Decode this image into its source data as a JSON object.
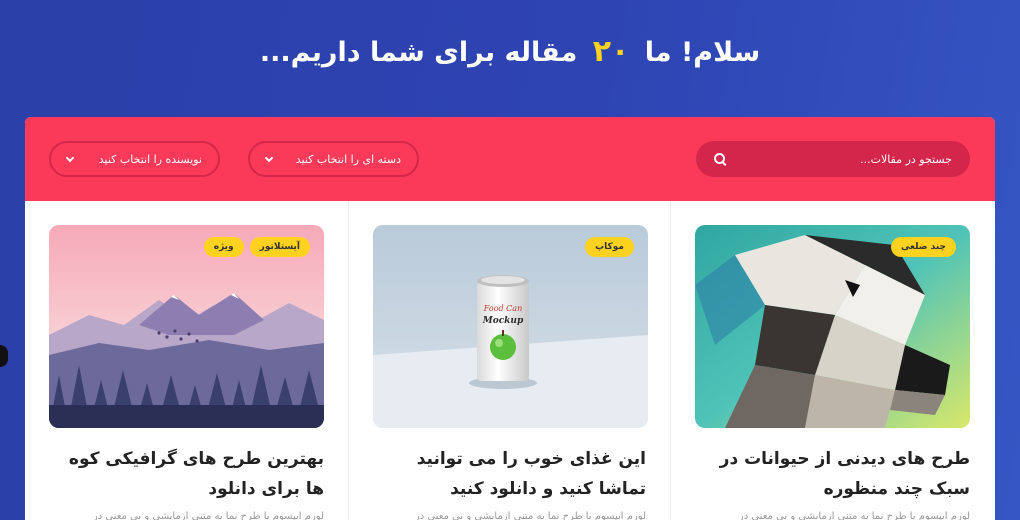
{
  "hero": {
    "prefix": "سلام! ما",
    "count": "۲۰",
    "suffix": "مقاله برای شما داریم..."
  },
  "filters": {
    "search_placeholder": "جستجو در مقالات...",
    "category_label": "دسته ای را انتخاب کنید",
    "author_label": "نویسنده را انتخاب کنید"
  },
  "colors": {
    "background": "#2e44b3",
    "filter_bar": "#fb3a5a",
    "tag": "#ffd21f"
  },
  "cards": [
    {
      "tags": [
        "چند ضلعی"
      ],
      "title": "طرح های دیدنی از حیوانات در سبک چند منظوره",
      "excerpt": "لورم ایپسوم یا طرح نما به متنی آزمایشی و بی معنی در",
      "image": "low-poly-dog"
    },
    {
      "tags": [
        "موکاپ"
      ],
      "title": "این غذای خوب را می توانید تماشا کنید و دانلود کنید",
      "excerpt": "لورم ایپسوم یا طرح نما به متنی آزمایشی و بی معنی در",
      "image": "can-mockup",
      "can_text": [
        "Food Can",
        "Mockup"
      ]
    },
    {
      "tags": [
        "آیستلاتور",
        "ویژه"
      ],
      "title": "بهترین طرح های گرافیکی کوه ها برای دانلود",
      "excerpt": "لورم ایپسوم یا طرح نما به متنی آزمایشی و بی معنی در",
      "image": "mountain-landscape"
    }
  ]
}
